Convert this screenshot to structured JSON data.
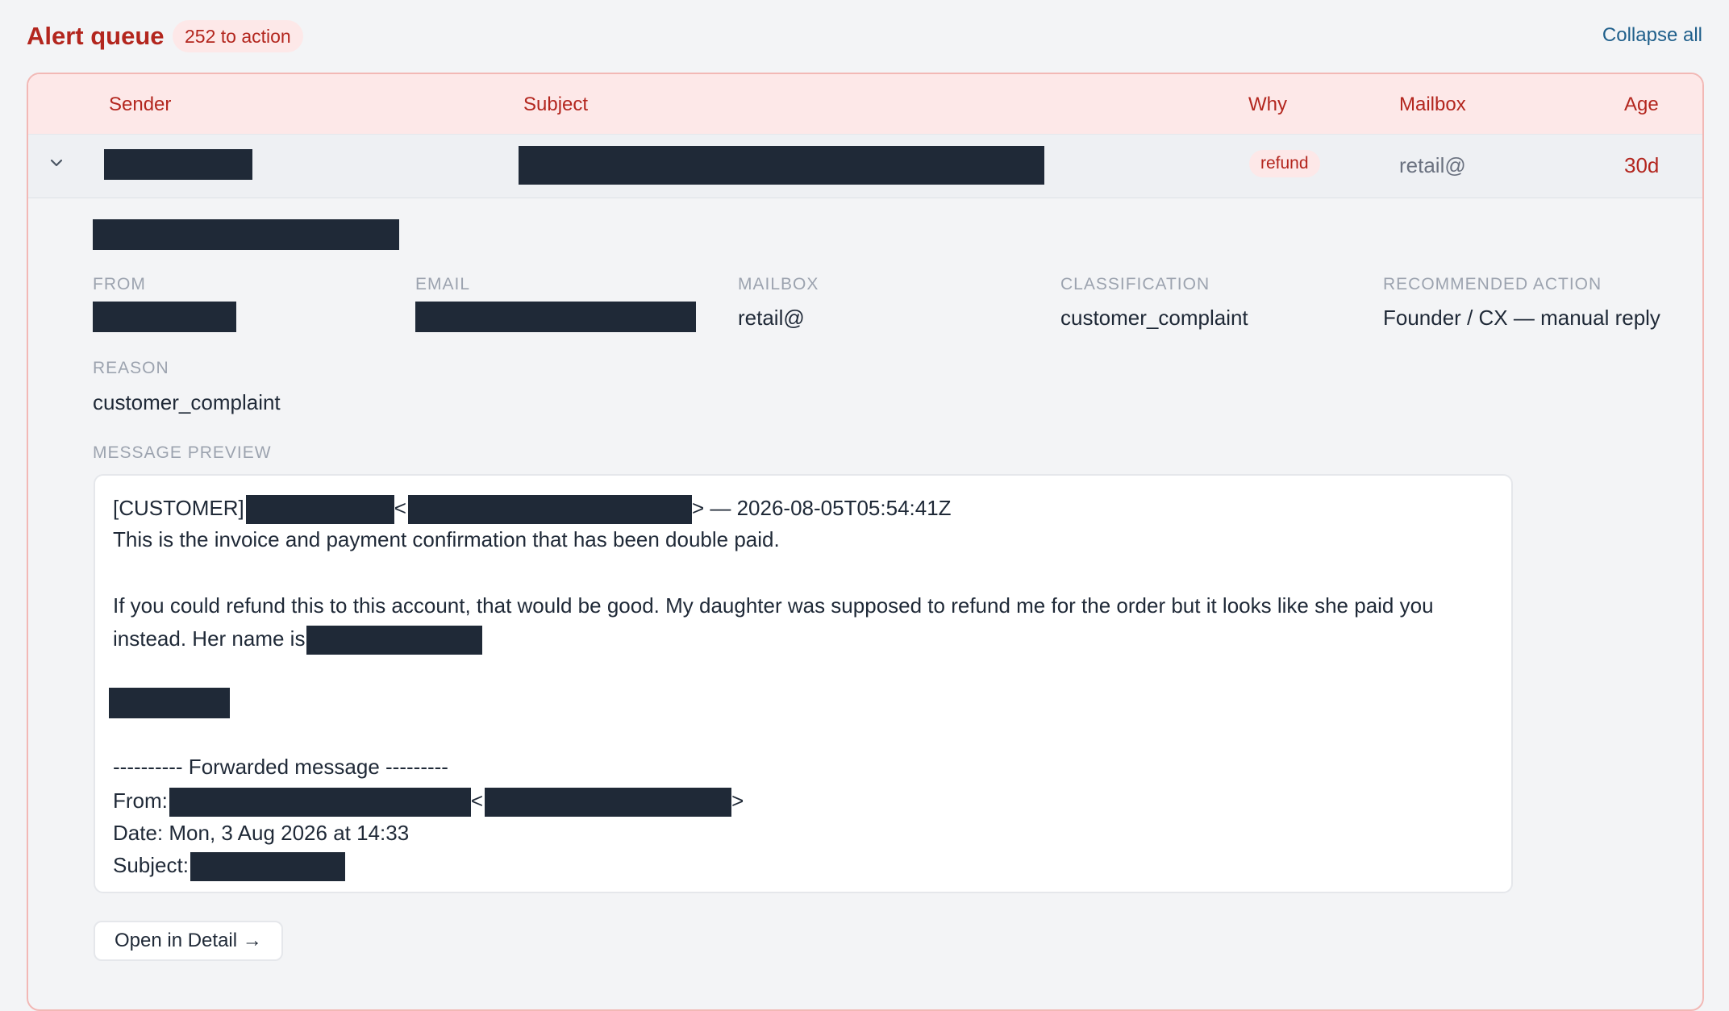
{
  "header": {
    "title": "Alert queue",
    "badge": "252 to action",
    "collapse_all": "Collapse all"
  },
  "columns": {
    "sender": "Sender",
    "subject": "Subject",
    "why": "Why",
    "mailbox": "Mailbox",
    "age": "Age"
  },
  "row": {
    "why": "refund",
    "mailbox": "retail@",
    "age": "30d"
  },
  "detail": {
    "from_label": "From",
    "email_label": "Email",
    "mailbox_label": "Mailbox",
    "mailbox_value": "retail@",
    "classification_label": "Classification",
    "classification_value": "customer_complaint",
    "action_label": "Recommended action",
    "action_value": "Founder / CX — manual reply",
    "reason_label": "Reason",
    "reason_value": "customer_complaint",
    "preview_label": "Message preview"
  },
  "preview": {
    "line1_prefix": "[CUSTOMER]",
    "lt": "<",
    "gt_suffix": "> — 2026-08-05T05:54:41Z",
    "line2": "This is the invoice and payment confirmation that has been double paid.",
    "line3": "If you could refund this to this account, that would be good. My daughter was supposed to refund me for the order but it looks like she paid you",
    "line4": "instead. Her name is",
    "forwarded": "---------- Forwarded message ---------",
    "from_prefix": "From:",
    "gt": ">",
    "date_line": "Date: Mon, 3 Aug 2026 at 14:33",
    "subject_prefix": "Subject:"
  },
  "actions": {
    "open_detail": "Open in Detail →"
  },
  "colors": {
    "accent": "#b3261e",
    "badge_bg": "#fde8e8",
    "link": "#1f5f8b",
    "redaction": "#1f2937"
  }
}
